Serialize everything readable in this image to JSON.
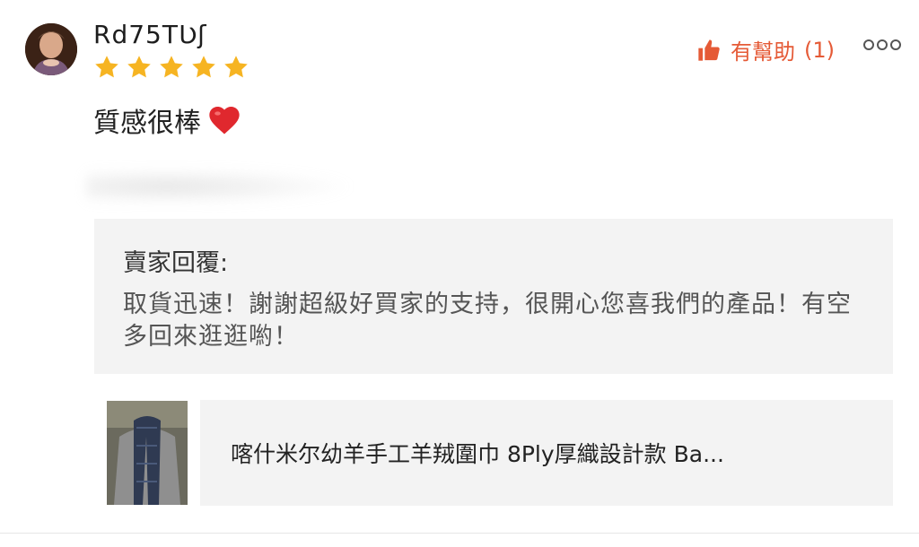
{
  "review": {
    "username": "Rd75TƲʃ",
    "rating": 5,
    "text": "質感很棒",
    "helpful_label": "有幫助",
    "helpful_count": "(1)",
    "more_menu": "more-options"
  },
  "seller_reply": {
    "title": "賣家回覆:",
    "body": "取貨迅速！謝謝超級好買家的支持，很開心您喜我們的產品！有空多回來逛逛喲！"
  },
  "product": {
    "name": "喀什米尔幼羊手工羊羢圍巾 8Ply厚織設計款 Ba..."
  },
  "colors": {
    "accent": "#e55a36",
    "star": "#f6b422",
    "panel_bg": "#f3f3f3"
  },
  "icons": [
    "thumbs-up-icon",
    "star-icon",
    "heart-emoji",
    "more-options-icon"
  ]
}
